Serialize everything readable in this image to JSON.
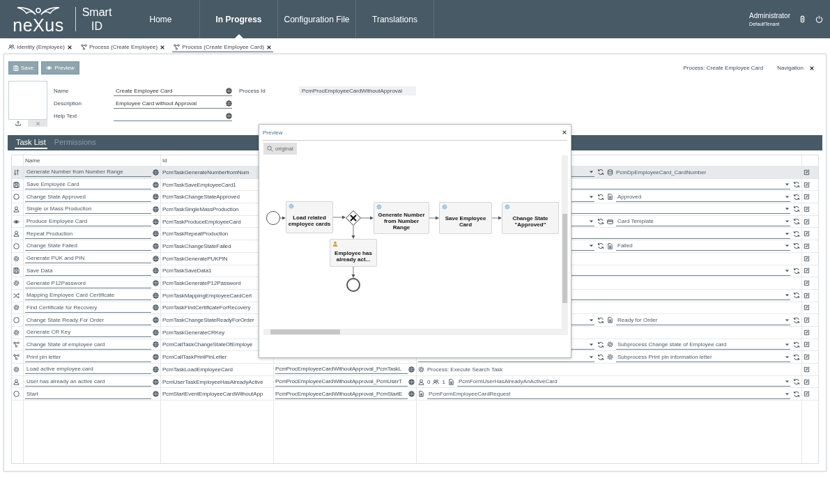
{
  "header": {
    "logo": "neXus",
    "product": "Smart ID",
    "nav": [
      {
        "label": "Home",
        "selected": false
      },
      {
        "label": "In Progress",
        "selected": true
      },
      {
        "label": "Configuration File",
        "selected": false
      },
      {
        "label": "Translations",
        "selected": false
      }
    ],
    "user": {
      "name": "Administrator",
      "tenant": "DefaultTenant"
    }
  },
  "doc_tabs": [
    {
      "kind": "identity",
      "label": "Identity (Employee)",
      "selected": false
    },
    {
      "kind": "process",
      "label": "Process (Create Employee)",
      "selected": false
    },
    {
      "kind": "process",
      "label": "Process (Create Employee Card)",
      "selected": true
    }
  ],
  "toolbar": {
    "buttons": [
      {
        "kind": "save",
        "label": "Save"
      },
      {
        "kind": "preview",
        "label": "Preview"
      }
    ],
    "breadcrumb": "Process: Create Employee Card",
    "navigation": "Navigation"
  },
  "form": {
    "fields": [
      {
        "label": "Name",
        "value": "Create Employee Card"
      },
      {
        "label": "Description",
        "value": "Employee Card without Approval"
      },
      {
        "label": "Help Text"
      }
    ],
    "process_id": {
      "label": "Process Id",
      "value": "PcmProcEmployeeCardWithoutApproval"
    }
  },
  "section_tabs": [
    {
      "label": "Task List",
      "selected": true
    },
    {
      "label": "Permissions",
      "selected": false
    }
  ],
  "task_table": {
    "columns": [
      "Name",
      "Id"
    ],
    "rows": [
      {
        "kind": "number",
        "name": "Generate Number from Number Range",
        "id": "PcmTaskGenerateNumberfromNum",
        "selected": true,
        "config": {
          "kind": "select_binding",
          "binding": {
            "kind": "data",
            "text": "PcmDpEmployeeCard_CardNumber",
            "dropdown": false
          }
        }
      },
      {
        "kind": "save",
        "name": "Save Employee Card",
        "id": "PcmTaskSaveEmployeeCard1",
        "selected": false,
        "config": {
          "kind": "select"
        }
      },
      {
        "kind": "event",
        "name": "Change State Approved",
        "id": "PcmTaskChangeStateApproved",
        "selected": false,
        "config": {
          "kind": "select_binding",
          "binding": {
            "kind": "doc",
            "text": "Approved",
            "dropdown": true
          }
        }
      },
      {
        "kind": "user",
        "name": "Single or Mass Production",
        "id": "PcmTaskSingleMassProduction",
        "selected": false,
        "config": {
          "kind": "select"
        }
      },
      {
        "kind": "eye",
        "name": "Produce Employee Card",
        "id": "PcmTaskProduceEmployeeCard",
        "selected": false,
        "config": {
          "kind": "select_binding",
          "binding": {
            "kind": "card",
            "text": "Card Template",
            "dropdown": true
          }
        }
      },
      {
        "kind": "user",
        "name": "Repeat Production",
        "id": "PcmTaskRepeatProduction",
        "selected": false,
        "config": {
          "kind": "select"
        }
      },
      {
        "kind": "event",
        "name": "Change State Failed",
        "id": "PcmTaskChangeStateFailed",
        "selected": false,
        "config": {
          "kind": "select_binding",
          "binding": {
            "kind": "doc",
            "text": "Failed",
            "dropdown": true
          }
        }
      },
      {
        "kind": "script",
        "name": "Generate PUK and PIN",
        "id": "PcmTaskGeneratePUKPIN",
        "selected": false,
        "config": {
          "kind": "none"
        }
      },
      {
        "kind": "save",
        "name": "Save Data",
        "id": "PcmTaskSaveData1",
        "selected": false,
        "config": {
          "kind": "select"
        }
      },
      {
        "kind": "script",
        "name": "Generate P12Password",
        "id": "PcmTaskGenerateP12Password",
        "selected": false,
        "config": {
          "kind": "none"
        }
      },
      {
        "kind": "mapping",
        "name": "Mapping Employee Card Certificate",
        "id": "PcmTaskMappingEmployeeCardCert",
        "selected": false,
        "config": {
          "kind": "select"
        }
      },
      {
        "kind": "script",
        "name": "Find Certificate for Recovery",
        "id": "PcmTaskFindCertificateForRecovery",
        "selected": false,
        "config": {
          "kind": "none"
        }
      },
      {
        "kind": "event",
        "name": "Change State Ready For Order",
        "id": "PcmTaskChangeStateReadyForOrder",
        "selected": false,
        "config": {
          "kind": "select_binding",
          "binding": {
            "kind": "doc",
            "text": "Ready for Order",
            "dropdown": true
          }
        }
      },
      {
        "kind": "script",
        "name": "Generate CR Key",
        "id": "PcmTaskGenerateCRKey",
        "selected": false,
        "config": {
          "kind": "none"
        }
      },
      {
        "kind": "call",
        "name": "Change State of employee card",
        "id": "PcmCallTaskChangeStateOfEmploye",
        "selected": false,
        "config": {
          "kind": "select_binding",
          "binding": {
            "kind": "script",
            "text": "Subprocess Change state of Employee card",
            "dropdown": true
          }
        }
      },
      {
        "kind": "call",
        "name": "Print pin letter",
        "id": "PcmCallTaskPrintPinLetter",
        "selected": false,
        "config": {
          "kind": "select_binding",
          "binding": {
            "kind": "script",
            "text": "Subprocess Print pin information letter",
            "dropdown": true
          }
        }
      },
      {
        "kind": "script",
        "name": "Load active employee card",
        "id": "PcmTaskLoadEmployeeCard",
        "column_3": "PcmProcEmployeeCardWithoutApproval_PcmTaskL",
        "selected": false,
        "config": {
          "kind": "binding",
          "binding": {
            "kind": "script",
            "text": "Process: Execute Search Task",
            "dropdown": false
          }
        }
      },
      {
        "kind": "user",
        "name": "User has already an active card",
        "id": "PcmUserTaskEmployeeHasAlreadyActive",
        "column_3": "PcmProcEmployeeCardWithoutApproval_PcmUserT",
        "selected": false,
        "config": {
          "kind": "binding",
          "counts": {
            "users": "0",
            "groups": "1"
          },
          "binding": {
            "kind": "doc",
            "text": "PcmFormUserHasAlreadyAnActiveCard",
            "dropdown": true
          }
        }
      },
      {
        "kind": "event",
        "name": "Start",
        "id": "PcmStartEventEmployeeCardWithoutApp",
        "column_3": "PcmProcEmployeeCardWithoutApproval_PcmStartE",
        "selected": false,
        "config": {
          "kind": "binding",
          "binding": {
            "kind": "doc",
            "text": "PcmFormEmployeeCardRequest",
            "dropdown": true
          }
        }
      }
    ]
  },
  "preview": {
    "title": "Preview",
    "zoom_button": "original",
    "diagram": {
      "nodes": [
        {
          "kind": "start"
        },
        {
          "kind": "service_task",
          "label": "Load related employee cards"
        },
        {
          "kind": "gateway"
        },
        {
          "kind": "service_task",
          "label": "Generate Number from Number Range"
        },
        {
          "kind": "service_task",
          "label": "Save Employee Card"
        },
        {
          "kind": "service_task",
          "label": "Change State \"Approved\""
        },
        {
          "kind": "user_task",
          "label": "Employee has already act..."
        },
        {
          "kind": "end"
        }
      ]
    }
  }
}
